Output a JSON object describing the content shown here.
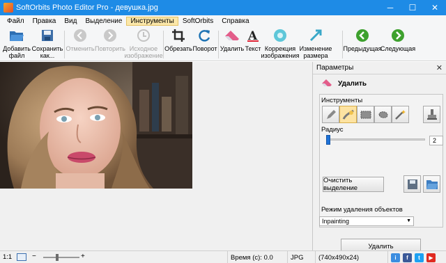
{
  "window": {
    "title": "SoftOrbits Photo Editor Pro - девушка.jpg",
    "min_glyph": "─",
    "max_glyph": "☐",
    "close_glyph": "✕"
  },
  "menu": [
    "Файл",
    "Правка",
    "Вид",
    "Выделение",
    "Инструменты",
    "SoftOrbits",
    "Справка"
  ],
  "toolbar": {
    "add_file": [
      "Добавить",
      "файл"
    ],
    "save_as": [
      "Сохранить",
      "как..."
    ],
    "undo": "Отменить",
    "redo": "Повторить",
    "original": [
      "Исходное",
      "изображение"
    ],
    "crop": "Обрезать",
    "rotate": "Поворот",
    "remove": "Удалить",
    "text": "Текст",
    "correction": [
      "Коррекция",
      "изображения"
    ],
    "resize": [
      "Изменение",
      "размера"
    ],
    "prev": "Предыдущая",
    "next": "Следующая"
  },
  "panel": {
    "header": "Параметры",
    "section_title": "Удалить",
    "tools_label": "Инструменты",
    "radius_label": "Радиус",
    "radius_value": "2",
    "clear_selection": "Очистить выделение",
    "mode_label": "Режим удаления объектов",
    "mode_value": "Inpainting",
    "delete_button": "Удалить"
  },
  "statusbar": {
    "zoom_ratio": "1:1",
    "time": "Время (с): 0.0",
    "format": "JPG",
    "dimensions": "(740x490x24)"
  },
  "colors": {
    "titlebar": "#1e8be6",
    "active_menu": "#fbe7a9",
    "selected_tool": "#fde3a2",
    "slider": "#1e73d9"
  }
}
